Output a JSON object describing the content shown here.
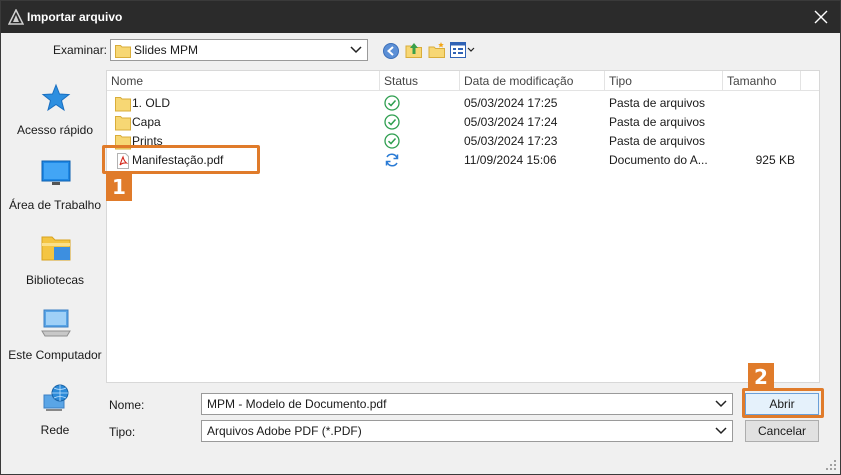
{
  "window": {
    "title": "Importar arquivo"
  },
  "lookin": {
    "label": "Examinar:",
    "value": "Slides MPM"
  },
  "places": [
    {
      "label": "Acesso rápido",
      "icon": "star-icon"
    },
    {
      "label": "Área de Trabalho",
      "icon": "desktop-icon"
    },
    {
      "label": "Bibliotecas",
      "icon": "library-folder-icon"
    },
    {
      "label": "Este Computador",
      "icon": "computer-icon"
    },
    {
      "label": "Rede",
      "icon": "network-globe-icon"
    }
  ],
  "columns": {
    "name": "Nome",
    "status": "Status",
    "modified": "Data de modificação",
    "type": "Tipo",
    "size": "Tamanho"
  },
  "files": [
    {
      "name": "1. OLD",
      "status": "synced",
      "modified": "05/03/2024 17:25",
      "type": "Pasta de arquivos",
      "size": "",
      "kind": "folder"
    },
    {
      "name": "Capa",
      "status": "synced",
      "modified": "05/03/2024 17:24",
      "type": "Pasta de arquivos",
      "size": "",
      "kind": "folder"
    },
    {
      "name": "Prints",
      "status": "synced",
      "modified": "05/03/2024 17:23",
      "type": "Pasta de arquivos",
      "size": "",
      "kind": "folder"
    },
    {
      "name": "Manifestação.pdf",
      "status": "syncing",
      "modified": "11/09/2024 15:06",
      "type": "Documento do A...",
      "size": "925 KB",
      "kind": "pdf"
    }
  ],
  "filename": {
    "label": "Nome:",
    "value": "MPM - Modelo de Documento.pdf"
  },
  "filetype": {
    "label": "Tipo:",
    "value": "Arquivos Adobe PDF (*.PDF)"
  },
  "buttons": {
    "open": "Abrir",
    "cancel": "Cancelar"
  },
  "callouts": {
    "first": "1",
    "second": "2"
  },
  "colors": {
    "accent": "#e07b2a",
    "titlebar": "#2b2b2b",
    "synced": "#2e9e4f",
    "syncing": "#2a7bd5"
  }
}
